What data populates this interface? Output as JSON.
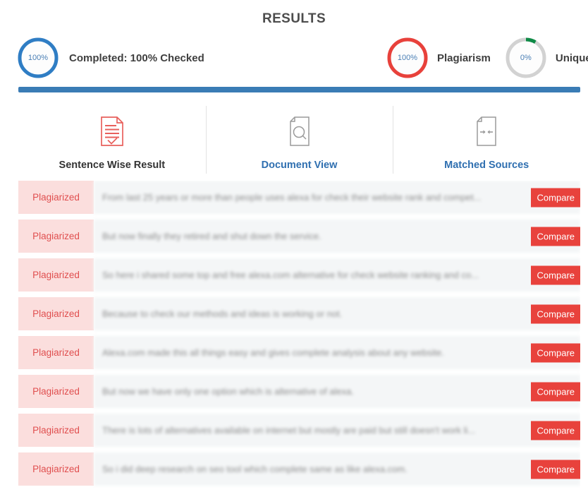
{
  "header": {
    "title": "RESULTS"
  },
  "summary": {
    "completed": {
      "percent_label": "100%",
      "percent": 100,
      "label": "Completed: 100% Checked",
      "ring_color": "#2f7dc4",
      "track_color": "#d8e6f3"
    },
    "plagiarism": {
      "percent_label": "100%",
      "percent": 100,
      "label": "Plagiarism",
      "ring_color": "#e8413b",
      "track_color": "#f6d7d6"
    },
    "unique": {
      "percent_label": "0%",
      "percent": 8,
      "label": "Unique",
      "ring_color": "#0e8a46",
      "track_color": "#d2d2d2"
    }
  },
  "tabs": [
    {
      "id": "sentence-wise-result",
      "label": "Sentence Wise Result",
      "icon": "document-check-icon",
      "active": true,
      "icon_color": "#e8605c"
    },
    {
      "id": "document-view",
      "label": "Document View",
      "icon": "document-search-icon",
      "active": false,
      "icon_color": "#9a9a9a"
    },
    {
      "id": "matched-sources",
      "label": "Matched Sources",
      "icon": "document-arrows-icon",
      "active": false,
      "icon_color": "#9a9a9a"
    }
  ],
  "results": {
    "badge_label": "Plagiarized",
    "compare_label": "Compare",
    "rows": [
      {
        "status": "Plagiarized",
        "sentence": "From last 25 years or more than people uses alexa for check their website rank and compet...",
        "action": "Compare"
      },
      {
        "status": "Plagiarized",
        "sentence": "But now finally they retired and shut down the service.",
        "action": "Compare"
      },
      {
        "status": "Plagiarized",
        "sentence": "So here i shared some top and free alexa.com alternative for check website ranking and co...",
        "action": "Compare"
      },
      {
        "status": "Plagiarized",
        "sentence": "Because to check our methods and ideas is working or not.",
        "action": "Compare"
      },
      {
        "status": "Plagiarized",
        "sentence": "Alexa.com made this all things easy and gives complete analysis about any website.",
        "action": "Compare"
      },
      {
        "status": "Plagiarized",
        "sentence": "But now we have only one option which is alternative of alexa.",
        "action": "Compare"
      },
      {
        "status": "Plagiarized",
        "sentence": "There is lots of alternatives available on internet but mostly are paid but still doesn't work li...",
        "action": "Compare"
      },
      {
        "status": "Plagiarized",
        "sentence": "So i did deep research on seo tool which complete same as like alexa.com.",
        "action": "Compare"
      }
    ]
  }
}
